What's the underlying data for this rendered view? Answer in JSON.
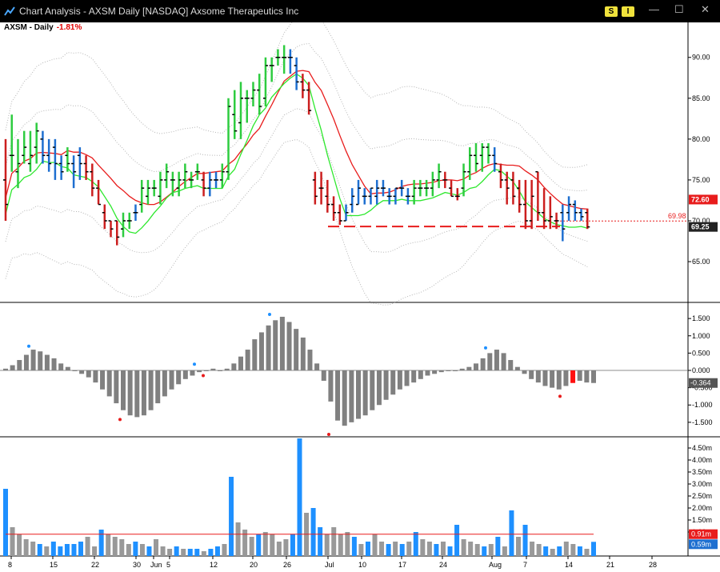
{
  "window": {
    "title": "Chart Analysis - AXSM Daily [NASDAQ] Axsome Therapeutics Inc",
    "btn_s": "S",
    "btn_i": "I",
    "minimize": "—",
    "maximize": "☐",
    "close": "✕"
  },
  "symbol": {
    "label": "AXSM - Daily",
    "change": "-1.81%"
  },
  "colors": {
    "up": "#2ecc40",
    "down": "#cc1f1f",
    "neutral": "#1e6fd0",
    "ma": "#e81c1c",
    "ma_fast": "#2ee82e",
    "hist": "#808080",
    "vol_blue": "#1e90ff",
    "vol_gray": "#999999"
  },
  "chart_data": [
    {
      "type": "ohlc",
      "panel": "price",
      "y_ticks": [
        "65.00",
        "70.00",
        "75.00",
        "80.00",
        "85.00",
        "90.00"
      ],
      "ylim": [
        60.5,
        93.5
      ],
      "x_tick_labels": [
        "8",
        "15",
        "22",
        "30",
        "Jun",
        "5",
        "12",
        "20",
        "26",
        "Jul",
        "10",
        "17",
        "24",
        "Aug",
        "7",
        "14",
        "21",
        "28"
      ],
      "price_labels": {
        "last": "69.25",
        "ma": "72.60",
        "ref": "69.98"
      },
      "bars": [
        {
          "o": 75,
          "h": 80,
          "l": 70,
          "c": 72,
          "col": "down"
        },
        {
          "o": 78,
          "h": 83,
          "l": 76,
          "c": 78,
          "col": "up"
        },
        {
          "o": 76,
          "h": 80,
          "l": 74,
          "c": 77,
          "col": "up"
        },
        {
          "o": 78,
          "h": 81,
          "l": 77,
          "c": 79,
          "col": "up"
        },
        {
          "o": 77,
          "h": 81,
          "l": 76,
          "c": 78,
          "col": "up"
        },
        {
          "o": 79,
          "h": 82,
          "l": 77,
          "c": 81,
          "col": "up"
        },
        {
          "o": 80,
          "h": 81,
          "l": 77,
          "c": 78,
          "col": "neutral"
        },
        {
          "o": 78,
          "h": 80,
          "l": 76,
          "c": 77,
          "col": "neutral"
        },
        {
          "o": 79,
          "h": 80,
          "l": 75,
          "c": 77,
          "col": "neutral"
        },
        {
          "o": 77,
          "h": 78,
          "l": 75,
          "c": 76,
          "col": "neutral"
        },
        {
          "o": 78,
          "h": 79,
          "l": 76,
          "c": 77,
          "col": "up"
        },
        {
          "o": 77,
          "h": 78,
          "l": 74,
          "c": 76,
          "col": "neutral"
        },
        {
          "o": 78,
          "h": 79,
          "l": 75,
          "c": 77,
          "col": "neutral"
        },
        {
          "o": 77,
          "h": 78,
          "l": 75,
          "c": 76,
          "col": "down"
        },
        {
          "o": 76,
          "h": 77,
          "l": 73,
          "c": 74,
          "col": "down"
        },
        {
          "o": 74,
          "h": 75,
          "l": 72,
          "c": 72,
          "col": "down"
        },
        {
          "o": 71,
          "h": 72,
          "l": 69,
          "c": 70,
          "col": "down"
        },
        {
          "o": 70,
          "h": 70,
          "l": 68,
          "c": 69,
          "col": "down"
        },
        {
          "o": 70,
          "h": 70,
          "l": 67,
          "c": 68,
          "col": "down"
        },
        {
          "o": 69,
          "h": 71,
          "l": 68,
          "c": 70,
          "col": "up"
        },
        {
          "o": 70,
          "h": 71,
          "l": 69,
          "c": 70,
          "col": "up"
        },
        {
          "o": 71,
          "h": 72,
          "l": 70,
          "c": 71,
          "col": "neutral"
        },
        {
          "o": 72,
          "h": 75,
          "l": 71,
          "c": 74,
          "col": "up"
        },
        {
          "o": 73,
          "h": 75,
          "l": 72,
          "c": 74,
          "col": "up"
        },
        {
          "o": 74,
          "h": 75,
          "l": 73,
          "c": 74,
          "col": "up"
        },
        {
          "o": 73,
          "h": 76,
          "l": 72,
          "c": 75,
          "col": "up"
        },
        {
          "o": 75,
          "h": 77,
          "l": 74,
          "c": 76,
          "col": "up"
        },
        {
          "o": 75,
          "h": 76,
          "l": 73,
          "c": 75,
          "col": "up"
        },
        {
          "o": 74,
          "h": 76,
          "l": 73,
          "c": 75,
          "col": "up"
        },
        {
          "o": 75,
          "h": 77,
          "l": 74,
          "c": 76,
          "col": "up"
        },
        {
          "o": 75,
          "h": 76,
          "l": 74,
          "c": 75,
          "col": "up"
        },
        {
          "o": 76,
          "h": 77,
          "l": 75,
          "c": 76,
          "col": "up"
        },
        {
          "o": 75,
          "h": 76,
          "l": 73,
          "c": 74,
          "col": "down"
        },
        {
          "o": 74,
          "h": 76,
          "l": 73,
          "c": 75,
          "col": "neutral"
        },
        {
          "o": 75,
          "h": 76,
          "l": 74,
          "c": 75,
          "col": "neutral"
        },
        {
          "o": 75,
          "h": 77,
          "l": 74,
          "c": 76,
          "col": "up"
        },
        {
          "o": 76,
          "h": 85,
          "l": 75,
          "c": 84,
          "col": "up"
        },
        {
          "o": 83,
          "h": 86,
          "l": 80,
          "c": 81,
          "col": "up"
        },
        {
          "o": 82,
          "h": 87,
          "l": 80,
          "c": 85,
          "col": "up"
        },
        {
          "o": 85,
          "h": 86,
          "l": 82,
          "c": 85,
          "col": "up"
        },
        {
          "o": 85,
          "h": 87,
          "l": 84,
          "c": 86,
          "col": "up"
        },
        {
          "o": 86,
          "h": 88,
          "l": 83,
          "c": 84,
          "col": "up"
        },
        {
          "o": 85,
          "h": 90,
          "l": 84,
          "c": 89,
          "col": "up"
        },
        {
          "o": 89,
          "h": 90,
          "l": 87,
          "c": 89,
          "col": "up"
        },
        {
          "o": 90,
          "h": 91,
          "l": 89,
          "c": 90,
          "col": "up"
        },
        {
          "o": 90,
          "h": 91.5,
          "l": 88,
          "c": 90,
          "col": "up"
        },
        {
          "o": 90,
          "h": 91,
          "l": 88,
          "c": 90,
          "col": "neutral"
        },
        {
          "o": 89,
          "h": 90,
          "l": 86,
          "c": 87,
          "col": "neutral"
        },
        {
          "o": 87,
          "h": 88,
          "l": 85,
          "c": 86,
          "col": "down"
        },
        {
          "o": 86,
          "h": 87,
          "l": 83,
          "c": 83.5,
          "col": "down"
        },
        {
          "o": 75,
          "h": 76,
          "l": 72,
          "c": 73,
          "col": "down"
        },
        {
          "o": 74,
          "h": 76,
          "l": 72,
          "c": 74,
          "col": "down"
        },
        {
          "o": 73,
          "h": 75,
          "l": 71,
          "c": 72,
          "col": "down"
        },
        {
          "o": 72,
          "h": 73,
          "l": 70,
          "c": 71,
          "col": "down"
        },
        {
          "o": 71,
          "h": 72,
          "l": 69.5,
          "c": 70,
          "col": "down"
        },
        {
          "o": 70,
          "h": 72,
          "l": 70,
          "c": 71,
          "col": "neutral"
        },
        {
          "o": 72,
          "h": 74,
          "l": 71,
          "c": 73,
          "col": "neutral"
        },
        {
          "o": 72,
          "h": 75,
          "l": 72,
          "c": 74,
          "col": "neutral"
        },
        {
          "o": 73,
          "h": 74,
          "l": 72,
          "c": 73,
          "col": "neutral"
        },
        {
          "o": 73,
          "h": 74,
          "l": 72,
          "c": 74,
          "col": "neutral"
        },
        {
          "o": 73,
          "h": 75,
          "l": 72,
          "c": 74,
          "col": "neutral"
        },
        {
          "o": 74,
          "h": 75,
          "l": 73,
          "c": 74,
          "col": "neutral"
        },
        {
          "o": 73,
          "h": 74,
          "l": 72,
          "c": 73,
          "col": "neutral"
        },
        {
          "o": 73,
          "h": 74,
          "l": 72,
          "c": 74,
          "col": "neutral"
        },
        {
          "o": 74,
          "h": 75,
          "l": 73,
          "c": 74,
          "col": "neutral"
        },
        {
          "o": 73,
          "h": 74,
          "l": 72,
          "c": 73,
          "col": "neutral"
        },
        {
          "o": 73,
          "h": 75,
          "l": 72,
          "c": 74,
          "col": "up"
        },
        {
          "o": 74,
          "h": 75,
          "l": 73,
          "c": 74,
          "col": "up"
        },
        {
          "o": 74,
          "h": 75,
          "l": 73,
          "c": 74,
          "col": "up"
        },
        {
          "o": 74,
          "h": 76,
          "l": 73,
          "c": 75,
          "col": "up"
        },
        {
          "o": 75,
          "h": 77,
          "l": 74,
          "c": 76,
          "col": "up"
        },
        {
          "o": 75,
          "h": 76,
          "l": 74,
          "c": 75,
          "col": "down"
        },
        {
          "o": 74,
          "h": 75,
          "l": 73,
          "c": 73,
          "col": "down"
        },
        {
          "o": 73,
          "h": 74,
          "l": 72.5,
          "c": 73,
          "col": "down"
        },
        {
          "o": 74,
          "h": 77,
          "l": 73,
          "c": 76,
          "col": "up"
        },
        {
          "o": 76,
          "h": 79,
          "l": 75,
          "c": 78,
          "col": "up"
        },
        {
          "o": 78,
          "h": 79.5,
          "l": 76,
          "c": 77,
          "col": "up"
        },
        {
          "o": 78,
          "h": 79.5,
          "l": 76,
          "c": 79,
          "col": "up"
        },
        {
          "o": 79,
          "h": 79.5,
          "l": 77,
          "c": 78,
          "col": "up"
        },
        {
          "o": 78,
          "h": 79,
          "l": 76,
          "c": 77,
          "col": "neutral"
        },
        {
          "o": 76,
          "h": 77,
          "l": 74,
          "c": 75,
          "col": "down"
        },
        {
          "o": 75,
          "h": 76,
          "l": 72,
          "c": 74,
          "col": "down"
        },
        {
          "o": 75,
          "h": 76,
          "l": 72,
          "c": 73,
          "col": "down"
        },
        {
          "o": 74,
          "h": 75,
          "l": 71,
          "c": 72,
          "col": "down"
        },
        {
          "o": 72,
          "h": 75,
          "l": 69,
          "c": 70,
          "col": "down"
        },
        {
          "o": 70,
          "h": 75,
          "l": 69,
          "c": 73,
          "col": "down"
        },
        {
          "o": 76,
          "h": 76,
          "l": 70,
          "c": 71,
          "col": "down"
        },
        {
          "o": 71,
          "h": 74,
          "l": 69,
          "c": 70,
          "col": "down"
        },
        {
          "o": 70,
          "h": 73,
          "l": 69,
          "c": 70.5,
          "col": "down"
        },
        {
          "o": 70,
          "h": 71,
          "l": 69,
          "c": 70,
          "col": "down"
        },
        {
          "o": 71,
          "h": 72,
          "l": 67.5,
          "c": 69,
          "col": "neutral"
        },
        {
          "o": 71,
          "h": 73,
          "l": 70,
          "c": 72,
          "col": "neutral"
        },
        {
          "o": 72,
          "h": 72.5,
          "l": 70,
          "c": 71,
          "col": "neutral"
        },
        {
          "o": 71,
          "h": 71.5,
          "l": 70,
          "c": 70.5,
          "col": "neutral"
        },
        {
          "o": 71,
          "h": 71.5,
          "l": 69,
          "c": 69.25,
          "col": "down"
        }
      ]
    },
    {
      "type": "bar",
      "panel": "oscillator",
      "y_ticks": [
        "-1.500",
        "-1.000",
        "-0.500",
        "0.000",
        "0.500",
        "1.000",
        "1.500"
      ],
      "ylim": [
        -1.85,
        1.85
      ],
      "last_value_label": "-0.364",
      "values": [
        0.05,
        0.15,
        0.3,
        0.45,
        0.6,
        0.55,
        0.45,
        0.35,
        0.2,
        0.1,
        0.0,
        -0.1,
        -0.2,
        -0.35,
        -0.55,
        -0.75,
        -0.95,
        -1.15,
        -1.3,
        -1.35,
        -1.3,
        -1.15,
        -0.95,
        -0.75,
        -0.55,
        -0.4,
        -0.25,
        -0.15,
        -0.05,
        0.0,
        0.05,
        0.0,
        0.05,
        0.2,
        0.4,
        0.6,
        0.9,
        1.1,
        1.3,
        1.45,
        1.55,
        1.4,
        1.2,
        0.95,
        0.6,
        0.2,
        -0.3,
        -0.9,
        -1.45,
        -1.6,
        -1.5,
        -1.4,
        -1.3,
        -1.15,
        -1.0,
        -0.85,
        -0.7,
        -0.55,
        -0.45,
        -0.35,
        -0.25,
        -0.15,
        -0.1,
        -0.05,
        0.0,
        0.0,
        0.05,
        0.1,
        0.2,
        0.35,
        0.5,
        0.6,
        0.5,
        0.3,
        0.1,
        -0.1,
        -0.25,
        -0.35,
        -0.45,
        -0.5,
        -0.55,
        -0.45,
        -0.364,
        -0.3,
        -0.35,
        -0.364
      ],
      "highlight_index": 82
    },
    {
      "type": "bar",
      "panel": "volume",
      "y_ticks": [
        "1.00m",
        "1.50m",
        "2.00m",
        "2.50m",
        "3.00m",
        "3.50m",
        "4.00m",
        "4.50m"
      ],
      "ylim": [
        0,
        4.9
      ],
      "labels": {
        "avg": "0.91m",
        "last": "0.59m"
      },
      "values": [
        2.8,
        1.2,
        0.9,
        0.7,
        0.6,
        0.5,
        0.4,
        0.6,
        0.4,
        0.5,
        0.5,
        0.6,
        0.8,
        0.4,
        1.1,
        0.9,
        0.8,
        0.7,
        0.5,
        0.6,
        0.5,
        0.4,
        0.7,
        0.4,
        0.3,
        0.4,
        0.3,
        0.3,
        0.3,
        0.2,
        0.3,
        0.4,
        0.5,
        3.3,
        1.4,
        1.1,
        0.8,
        0.9,
        1.0,
        0.9,
        0.6,
        0.7,
        0.9,
        4.9,
        1.8,
        2.0,
        1.2,
        0.9,
        1.2,
        0.9,
        1.0,
        0.8,
        0.5,
        0.6,
        0.9,
        0.6,
        0.5,
        0.6,
        0.5,
        0.6,
        1.0,
        0.7,
        0.6,
        0.5,
        0.6,
        0.4,
        1.3,
        0.7,
        0.6,
        0.5,
        0.4,
        0.5,
        0.8,
        0.4,
        1.9,
        0.8,
        1.3,
        0.6,
        0.5,
        0.4,
        0.3,
        0.4,
        0.6,
        0.5,
        0.4,
        0.3,
        0.59
      ],
      "vol_colors": [
        "b",
        "g",
        "g",
        "g",
        "g",
        "b",
        "g",
        "b",
        "b",
        "b",
        "b",
        "b",
        "g",
        "g",
        "b",
        "g",
        "g",
        "g",
        "g",
        "b",
        "g",
        "b",
        "g",
        "g",
        "g",
        "b",
        "g",
        "b",
        "b",
        "g",
        "b",
        "b",
        "g",
        "b",
        "g",
        "g",
        "g",
        "b",
        "g",
        "g",
        "g",
        "g",
        "b",
        "b",
        "g",
        "b",
        "b",
        "g",
        "g",
        "g",
        "g",
        "b",
        "g",
        "b",
        "g",
        "g",
        "b",
        "g",
        "b",
        "g",
        "b",
        "g",
        "g",
        "b",
        "g",
        "b",
        "b",
        "g",
        "g",
        "g",
        "b",
        "g",
        "b",
        "g",
        "b",
        "g",
        "b",
        "g",
        "g",
        "b",
        "g",
        "b",
        "g",
        "g",
        "b",
        "g",
        "b"
      ],
      "avg_line": 0.91
    }
  ]
}
